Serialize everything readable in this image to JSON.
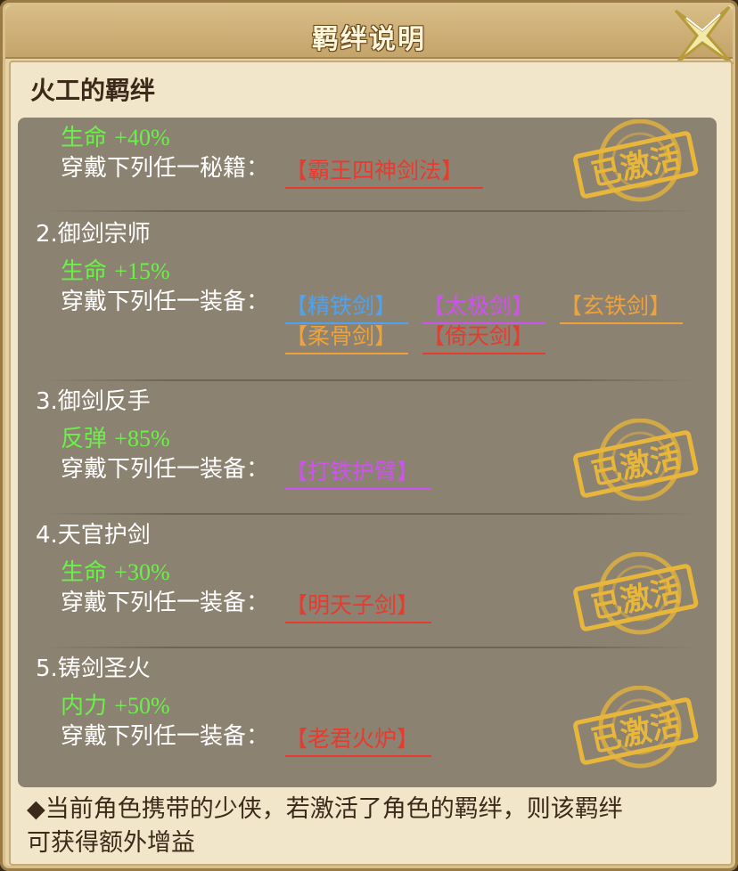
{
  "dialog": {
    "title": "羁绊说明",
    "close_icon": "close-x-icon"
  },
  "hero": {
    "title": "火工的羁绊"
  },
  "bonds": [
    {
      "name": "",
      "stat_label": "生命",
      "stat_value": "+40%",
      "requirement": "穿戴下列任一秘籍：",
      "items": [
        {
          "label": "【霸王四神剑法】",
          "color": "#e63b2e"
        }
      ],
      "activated": true
    },
    {
      "name": "2.御剑宗师",
      "stat_label": "生命",
      "stat_value": "+15%",
      "requirement": "穿戴下列任一装备：",
      "items": [
        {
          "label": "【精铁剑】",
          "color": "#4da3f0"
        },
        {
          "label": "【太极剑】",
          "color": "#cf52f0"
        },
        {
          "label": "【玄铁剑】",
          "color": "#f0a23a"
        },
        {
          "label": "【柔骨剑】",
          "color": "#f0a23a"
        },
        {
          "label": "【倚天剑】",
          "color": "#e63b2e"
        }
      ],
      "activated": false
    },
    {
      "name": "3.御剑反手",
      "stat_label": "反弹",
      "stat_value": "+85%",
      "requirement": "穿戴下列任一装备：",
      "items": [
        {
          "label": "【打铁护臂】",
          "color": "#cf52f0"
        }
      ],
      "activated": true
    },
    {
      "name": "4.天官护剑",
      "stat_label": "生命",
      "stat_value": "+30%",
      "requirement": "穿戴下列任一装备：",
      "items": [
        {
          "label": "【明天子剑】",
          "color": "#e63b2e"
        }
      ],
      "activated": true
    },
    {
      "name": "5.铸剑圣火",
      "stat_label": "内力",
      "stat_value": "+50%",
      "requirement": "穿戴下列任一装备：",
      "items": [
        {
          "label": "【老君火炉】",
          "color": "#e63b2e"
        }
      ],
      "activated": true
    }
  ],
  "stamp_text": "已激活",
  "footer": {
    "line1": "◆当前角色携带的少侠，若激活了角色的羁绊，则该羁绊",
    "line2": "可获得额外增益"
  },
  "colors": {
    "stat_green": "#6bf04a",
    "stamp_gold": "#e8b63a"
  }
}
